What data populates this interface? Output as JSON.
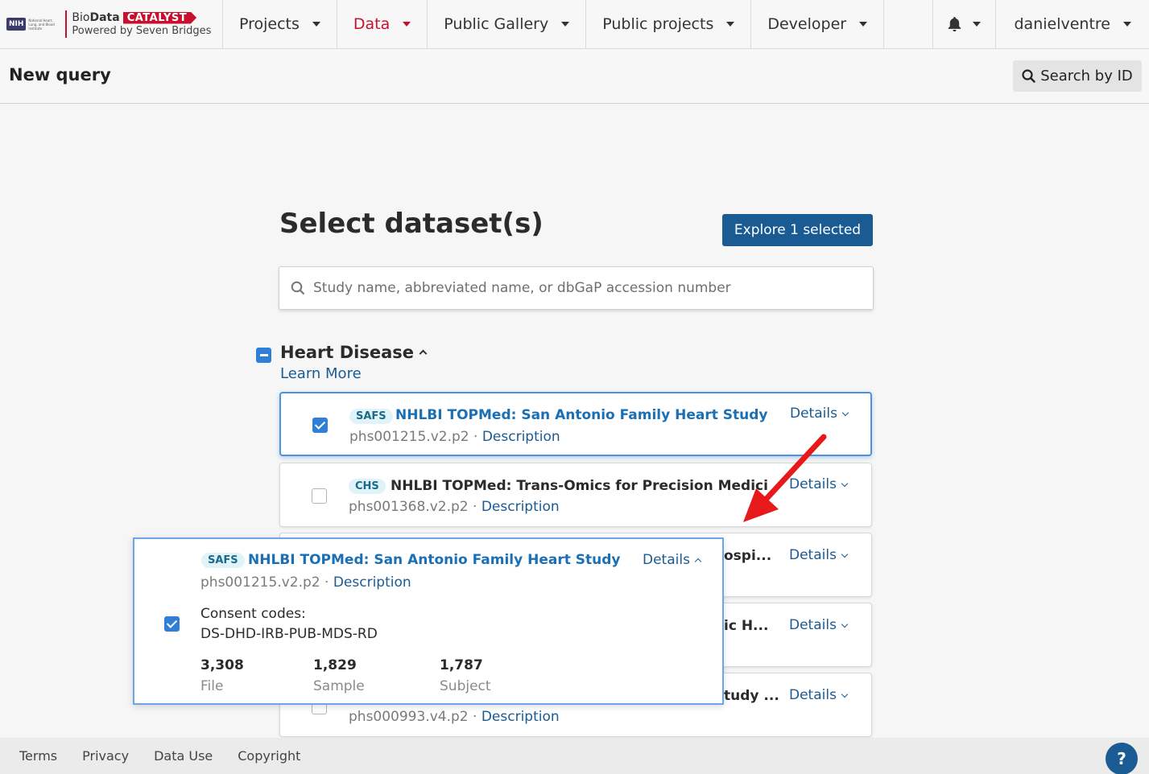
{
  "brand": {
    "nih": "NIH",
    "nih_text": "National Heart, Lung, and Blood Institute",
    "biodata_light": "Bio",
    "biodata_bold": "Data",
    "catalyst": "CATALYST",
    "powered": "Powered by Seven Bridges"
  },
  "nav": {
    "items": [
      {
        "label": "Projects",
        "active": false
      },
      {
        "label": "Data",
        "active": true
      },
      {
        "label": "Public Gallery",
        "active": false
      },
      {
        "label": "Public projects",
        "active": false
      },
      {
        "label": "Developer",
        "active": false
      }
    ],
    "user": "danielventre"
  },
  "subheader": {
    "title": "New query",
    "search_by_id": "Search by ID"
  },
  "main": {
    "title": "Select dataset(s)",
    "explore_button": "Explore 1 selected",
    "search_placeholder": "Study name, abbreviated name, or dbGaP accession number",
    "category": {
      "title": "Heart Disease",
      "learn_more": "Learn More"
    },
    "details_label": "Details",
    "description_label": "Description",
    "separator": " · ",
    "studies": [
      {
        "abbr": "SAFS",
        "name": "NHLBI TOPMed: San Antonio Family Heart Study ...",
        "accession": "phs001215.v2.p2",
        "checked": true
      },
      {
        "abbr": "CHS",
        "name": "NHLBI TOPMed: Trans-Omics for Precision Medici...",
        "accession": "phs001368.v2.p2",
        "checked": false
      },
      {
        "abbr": "",
        "name": "ospi...",
        "accession": "",
        "checked": false
      },
      {
        "abbr": "",
        "name": "ic H...",
        "accession": "",
        "checked": false
      },
      {
        "abbr": "",
        "name": "tudy ...",
        "accession": "phs000993.v4.p2",
        "checked": false
      }
    ]
  },
  "popup": {
    "abbr": "SAFS",
    "name": "NHLBI TOPMed: San Antonio Family Heart Study ...",
    "details": "Details",
    "accession": "phs001215.v2.p2",
    "description": "Description",
    "consent_label": "Consent codes:",
    "consent_code": "DS-DHD-IRB-PUB-MDS-RD",
    "stats": [
      {
        "value": "3,308",
        "label": "File"
      },
      {
        "value": "1,829",
        "label": "Sample"
      },
      {
        "value": "1,787",
        "label": "Subject"
      }
    ]
  },
  "footer": {
    "links": [
      "Terms",
      "Privacy",
      "Data Use",
      "Copyright"
    ],
    "help": "?"
  },
  "colors": {
    "brand_red": "#c8102e",
    "primary_blue": "#1a5b94",
    "check_blue": "#2f7fd8",
    "annotation_arrow": "#e8191a"
  }
}
